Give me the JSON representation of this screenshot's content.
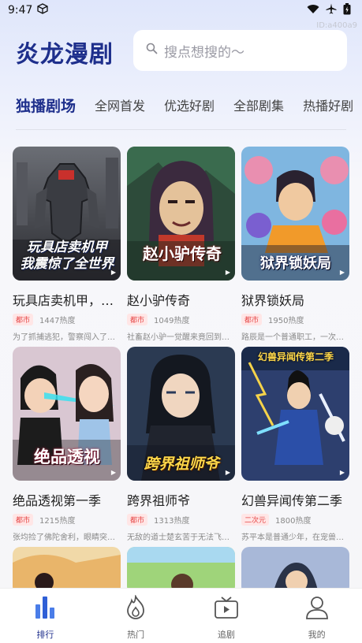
{
  "status_bar": {
    "time": "9:47"
  },
  "watermark": "ID:a400a9",
  "app_title": "炎龙漫剧",
  "search": {
    "placeholder": "搜点想搜的～"
  },
  "tabs": [
    {
      "label": "独播剧场",
      "active": true
    },
    {
      "label": "全网首发",
      "active": false
    },
    {
      "label": "优选好剧",
      "active": false
    },
    {
      "label": "全部剧集",
      "active": false
    },
    {
      "label": "热播好剧",
      "active": false
    }
  ],
  "cards": [
    {
      "title": "玩具店卖机甲，我震惊了全世界",
      "cover_text": "玩具店卖机甲\n我震惊了全世界",
      "tag": "都市",
      "heat": "1447热度",
      "desc": "为了抓捕逃犯，警察闯入了一家玩具店"
    },
    {
      "title": "赵小驴传奇",
      "cover_text": "赵小驴传奇",
      "tag": "都市",
      "heat": "1049热度",
      "desc": "社畜赵小驴一觉醒来竟回到古代……"
    },
    {
      "title": "狱界锁妖局",
      "cover_text": "狱界锁妖局",
      "tag": "都市",
      "heat": "1950热度",
      "desc": "路辰是一个普通职工，一次深夜加班"
    },
    {
      "title": "绝品透视第一季",
      "cover_text": "绝品透视",
      "tag": "都市",
      "heat": "1215热度",
      "desc": "张均捡了佛陀舍利，眼睛突然获得透视"
    },
    {
      "title": "跨界祖师爷",
      "cover_text": "跨界祖师爷",
      "tag": "都市",
      "heat": "1313热度",
      "desc": "无敌的道士楚玄苦于无法飞升……"
    },
    {
      "title": "幻兽异闻传第二季",
      "cover_text": "幻兽异闻传第二季",
      "tag": "二次元",
      "heat": "1800热度",
      "desc": "苏平本是普通少年，在宠兽时代觉醒"
    }
  ],
  "bottom_nav": [
    {
      "label": "排行",
      "icon": "bar-chart-icon",
      "active": true
    },
    {
      "label": "热门",
      "icon": "flame-icon",
      "active": false
    },
    {
      "label": "追剧",
      "icon": "tv-icon",
      "active": false
    },
    {
      "label": "我的",
      "icon": "user-icon",
      "active": false
    }
  ],
  "colors": {
    "brand": "#1e2f8c",
    "tag_bg": "#ffe6e6",
    "tag_text": "#e64848"
  }
}
